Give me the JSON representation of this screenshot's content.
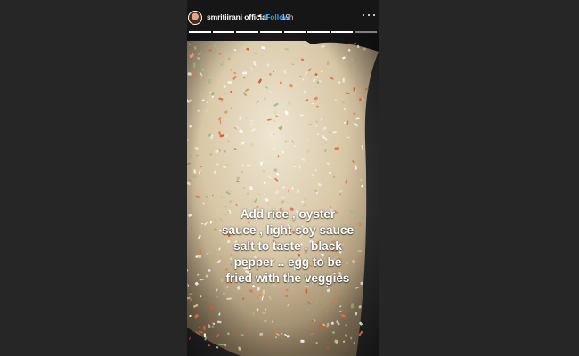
{
  "story": {
    "username": "smritiirani official",
    "separator": "•",
    "follow_label": "Follow",
    "timestamp": "19h",
    "more_icon": "more-options-icon",
    "segments": [
      {
        "seen": true
      },
      {
        "seen": true
      },
      {
        "seen": true
      },
      {
        "seen": true
      },
      {
        "seen": true
      },
      {
        "seen": true
      },
      {
        "seen": true
      },
      {
        "seen": false
      }
    ],
    "caption_lines": [
      "Add rice , oyster",
      "sauce , light soy sauce",
      "salt to taste , black",
      "pepper .. egg to be",
      "fried with the veggies"
    ],
    "image_subject": "fried rice with vegetables in a black wok"
  },
  "colors": {
    "page_background": "#262626",
    "follow_link": "#3897f0",
    "text": "#ffffff"
  }
}
